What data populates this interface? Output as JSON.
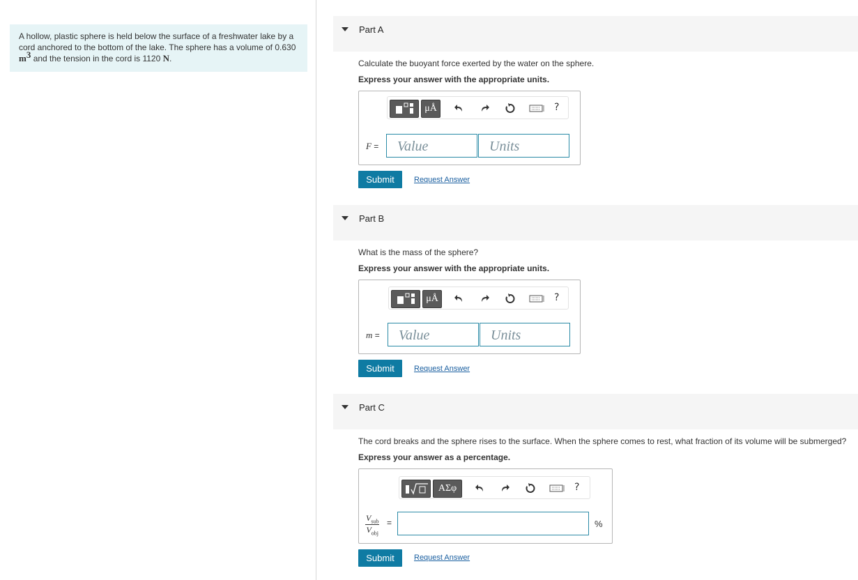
{
  "problem": {
    "text_1": "A hollow, plastic sphere is held below the surface of a freshwater lake by a cord anchored to the bottom of the lake. The sphere has a volume of",
    "volume_value": "0.630",
    "volume_unit": "m",
    "volume_exp": "3",
    "text_2": "and the tension in the cord is 1120",
    "tension_unit": "N",
    "text_3": "."
  },
  "parts": [
    {
      "title": "Part A",
      "question": "Calculate the buoyant force exerted by the water on the sphere.",
      "instruction": "Express your answer with the appropriate units.",
      "var_label": "F",
      "equals": "=",
      "value_placeholder": "Value",
      "units_placeholder": "Units",
      "toolbar_button_2": "μÅ",
      "help": "?",
      "submit": "Submit",
      "request": "Request Answer"
    },
    {
      "title": "Part B",
      "question": "What is the mass of the sphere?",
      "instruction": "Express your answer with the appropriate units.",
      "var_label": "m",
      "equals": "=",
      "value_placeholder": "Value",
      "units_placeholder": "Units",
      "toolbar_button_2": "μÅ",
      "help": "?",
      "submit": "Submit",
      "request": "Request Answer"
    },
    {
      "title": "Part C",
      "question": "The cord breaks and the sphere rises to the surface. When the sphere comes to rest, what fraction of its volume will be submerged?",
      "instruction": "Express your answer as a percentage.",
      "frac_num": "V",
      "frac_num_sub": "sub",
      "frac_den": "V",
      "frac_den_sub": "obj",
      "equals": "=",
      "unit": "%",
      "toolbar_button_2": "ΑΣφ",
      "help": "?",
      "submit": "Submit",
      "request": "Request Answer"
    }
  ]
}
